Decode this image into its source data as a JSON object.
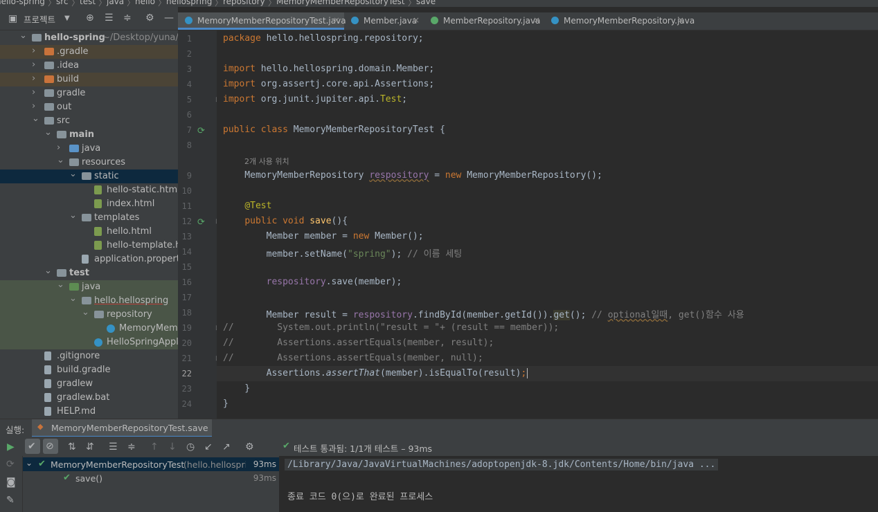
{
  "breadcrumb": [
    "hello-spring",
    "src",
    "test",
    "java",
    "hello",
    "hellospring",
    "repository",
    "MemoryMemberRepositoryTest",
    "save"
  ],
  "project": {
    "title": "프로젝트",
    "tree": [
      {
        "label": "hello-spring",
        "suffix": "~/Desktop/yuna/stud",
        "depth": 0,
        "arrow": "v",
        "icon": "fold"
      },
      {
        "label": ".gradle",
        "depth": 1,
        "arrow": ">",
        "icon": "fold-or"
      },
      {
        "label": ".idea",
        "depth": 1,
        "arrow": ">",
        "icon": "fold"
      },
      {
        "label": "build",
        "depth": 1,
        "arrow": ">",
        "icon": "fold-or"
      },
      {
        "label": "gradle",
        "depth": 1,
        "arrow": ">",
        "icon": "fold"
      },
      {
        "label": "out",
        "depth": 1,
        "arrow": ">",
        "icon": "fold"
      },
      {
        "label": "src",
        "depth": 1,
        "arrow": "v",
        "icon": "fold"
      },
      {
        "label": "main",
        "depth": 2,
        "arrow": "v",
        "icon": "fold"
      },
      {
        "label": "java",
        "depth": 3,
        "arrow": ">",
        "icon": "fold-bl"
      },
      {
        "label": "resources",
        "depth": 3,
        "arrow": "v",
        "icon": "fold"
      },
      {
        "label": "static",
        "depth": 4,
        "arrow": "v",
        "icon": "fold"
      },
      {
        "label": "hello-static.html",
        "depth": 5,
        "arrow": "",
        "icon": "file-h"
      },
      {
        "label": "index.html",
        "depth": 5,
        "arrow": "",
        "icon": "file-h"
      },
      {
        "label": "templates",
        "depth": 4,
        "arrow": "v",
        "icon": "fold"
      },
      {
        "label": "hello.html",
        "depth": 5,
        "arrow": "",
        "icon": "file-h"
      },
      {
        "label": "hello-template.html",
        "depth": 5,
        "arrow": "",
        "icon": "file-h"
      },
      {
        "label": "application.properties",
        "depth": 4,
        "arrow": "",
        "icon": "file-g"
      },
      {
        "label": "test",
        "depth": 2,
        "arrow": "v",
        "icon": "fold"
      },
      {
        "label": "java",
        "depth": 3,
        "arrow": "v",
        "icon": "fold-gr"
      },
      {
        "label": "hello.hellospring",
        "depth": 4,
        "arrow": "v",
        "icon": "fold"
      },
      {
        "label": "repository",
        "depth": 5,
        "arrow": "v",
        "icon": "fold"
      },
      {
        "label": "MemoryMemberR",
        "depth": 6,
        "arrow": "",
        "icon": "file-c"
      },
      {
        "label": "HelloSpringApplicat",
        "depth": 5,
        "arrow": "",
        "icon": "file-c"
      },
      {
        "label": ".gitignore",
        "depth": 1,
        "arrow": "",
        "icon": "file-g"
      },
      {
        "label": "build.gradle",
        "depth": 1,
        "arrow": "",
        "icon": "file-g"
      },
      {
        "label": "gradlew",
        "depth": 1,
        "arrow": "",
        "icon": "file-g"
      },
      {
        "label": "gradlew.bat",
        "depth": 1,
        "arrow": "",
        "icon": "file-g"
      },
      {
        "label": "HELP.md",
        "depth": 1,
        "arrow": "",
        "icon": "file-g"
      }
    ]
  },
  "tabs": [
    {
      "label": "MemoryMemberRepositoryTest.java",
      "active": true,
      "icon_color": "#3592c4"
    },
    {
      "label": "Member.java",
      "active": false,
      "icon_color": "#3592c4"
    },
    {
      "label": "MemberRepository.java",
      "active": false,
      "icon_color": "#59a869"
    },
    {
      "label": "MemoryMemberRepository.java",
      "active": false,
      "icon_color": "#3592c4"
    }
  ],
  "editor": {
    "usage_hint": "2개 사용 위치",
    "line_numbers": [
      "1",
      "2",
      "3",
      "4",
      "5",
      "6",
      "7",
      "8",
      "9",
      "10",
      "11",
      "12",
      "13",
      "14",
      "15",
      "16",
      "17",
      "18",
      "19",
      "20",
      "21",
      "22",
      "23",
      "24"
    ]
  },
  "run": {
    "label": "실행:",
    "config": "MemoryMemberRepositoryTest.save",
    "status": "테스트 통과됨: 1/1개 테스트 – 93ms",
    "tests": [
      {
        "name": "MemoryMemberRepositoryTest",
        "detail": "(hello.hellosprin",
        "time": "93ms"
      },
      {
        "name": "save()",
        "detail": "",
        "time": "93ms"
      }
    ],
    "console": [
      "/Library/Java/JavaVirtualMachines/adoptopenjdk-8.jdk/Contents/Home/bin/java ...",
      "",
      "종료 코드 0(으)로 완료된 프로세스"
    ]
  },
  "colors": {
    "accent": "#4a88c7",
    "pass": "#59a869",
    "keyword": "#cc7832",
    "field": "#9876aa",
    "string": "#6a8759",
    "comment": "#808080"
  }
}
